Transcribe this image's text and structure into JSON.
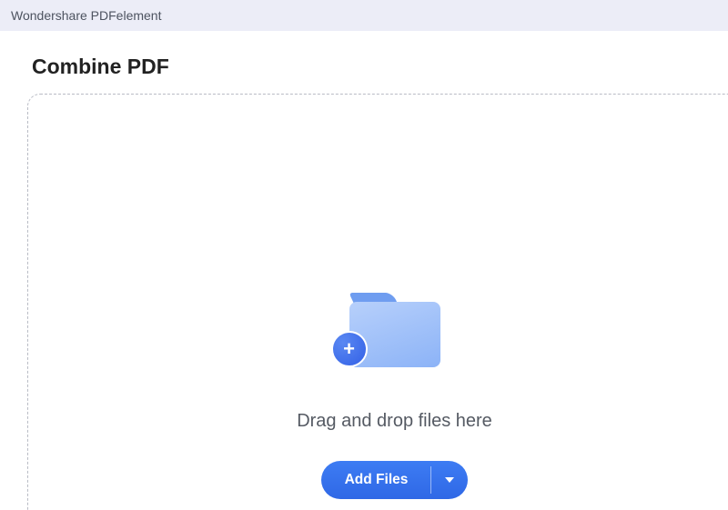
{
  "titlebar": {
    "appName": "Wondershare PDFelement"
  },
  "page": {
    "title": "Combine PDF"
  },
  "dropzone": {
    "hint": "Drag and drop files here",
    "addFilesLabel": "Add Files"
  }
}
